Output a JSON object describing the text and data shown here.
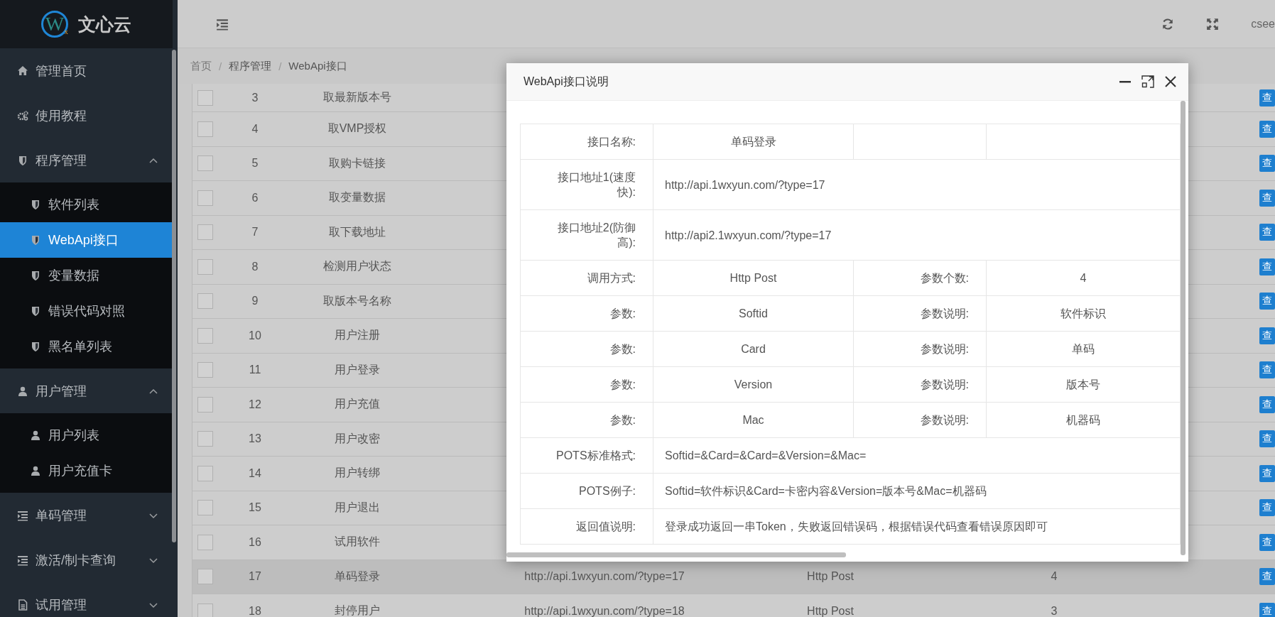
{
  "sidebar": {
    "logo_mark": "W",
    "logo_sub": "x",
    "brand": "文心云",
    "items": [
      {
        "label": "管理首页",
        "selected": false
      },
      {
        "label": "使用教程",
        "selected": false
      },
      {
        "label": "程序管理",
        "selected": false,
        "expanded": true,
        "children": [
          {
            "label": "软件列表",
            "selected": false
          },
          {
            "label": "WebApi接口",
            "selected": true
          },
          {
            "label": "变量数据",
            "selected": false
          },
          {
            "label": "错误代码对照",
            "selected": false
          },
          {
            "label": "黑名单列表",
            "selected": false
          }
        ]
      },
      {
        "label": "用户管理",
        "selected": false,
        "expanded": true,
        "children": [
          {
            "label": "用户列表",
            "selected": false
          },
          {
            "label": "用户充值卡",
            "selected": false
          }
        ]
      },
      {
        "label": "单码管理",
        "selected": false,
        "expanded": false
      },
      {
        "label": "激活/制卡查询",
        "selected": false,
        "expanded": false
      },
      {
        "label": "试用管理",
        "selected": false,
        "expanded": false
      }
    ]
  },
  "topbar": {
    "user": "csee"
  },
  "breadcrumb": {
    "separator": "/",
    "items": [
      "首页",
      "程序管理",
      "WebApi接口"
    ]
  },
  "table": {
    "rows": [
      {
        "index": "3",
        "name": "取最新版本号",
        "checked": false,
        "selected": false,
        "button": "查"
      },
      {
        "index": "4",
        "name": "取VMP授权",
        "checked": false,
        "selected": false,
        "button": "查"
      },
      {
        "index": "5",
        "name": "取购卡链接",
        "checked": false,
        "selected": false,
        "button": "查"
      },
      {
        "index": "6",
        "name": "取变量数据",
        "checked": false,
        "selected": false,
        "button": "查"
      },
      {
        "index": "7",
        "name": "取下载地址",
        "checked": false,
        "selected": false,
        "button": "查"
      },
      {
        "index": "8",
        "name": "检测用户状态",
        "checked": false,
        "selected": false,
        "button": "查"
      },
      {
        "index": "9",
        "name": "取版本号名称",
        "checked": false,
        "selected": false,
        "button": "查"
      },
      {
        "index": "10",
        "name": "用户注册",
        "checked": false,
        "selected": false,
        "button": "查"
      },
      {
        "index": "11",
        "name": "用户登录",
        "checked": false,
        "selected": false,
        "button": "查"
      },
      {
        "index": "12",
        "name": "用户充值",
        "checked": false,
        "selected": false,
        "button": "查"
      },
      {
        "index": "13",
        "name": "用户改密",
        "checked": false,
        "selected": false,
        "button": "查"
      },
      {
        "index": "14",
        "name": "用户转绑",
        "checked": false,
        "selected": false,
        "button": "查"
      },
      {
        "index": "15",
        "name": "用户退出",
        "checked": false,
        "selected": false,
        "button": "查"
      },
      {
        "index": "16",
        "name": "试用软件",
        "checked": false,
        "selected": false,
        "button": "查"
      },
      {
        "index": "17",
        "name": "单码登录",
        "checked": false,
        "selected": true,
        "url": "http://api.1wxyun.com/?type=17",
        "method": "Http Post",
        "param_count": "4",
        "button": "查"
      },
      {
        "index": "18",
        "name": "封停用户",
        "checked": false,
        "selected": false,
        "url": "http://api.1wxyun.com/?type=18",
        "method": "Http Post",
        "param_count": "3",
        "button": "查"
      }
    ]
  },
  "dialog": {
    "title": "WebApi接口说明",
    "rows": [
      {
        "kind": "quad",
        "cells": [
          "接口名称:",
          "单码登录"
        ]
      },
      {
        "kind": "wide",
        "cells": [
          "接口地址1(速度快):",
          {
            "text": "http://api.1wxyun.com/?type=17",
            "colspan": 3
          }
        ]
      },
      {
        "kind": "wide",
        "cells": [
          "接口地址2(防御高):",
          {
            "text": "http://api2.1wxyun.com/?type=17",
            "colspan": 3
          }
        ]
      },
      {
        "kind": "quad",
        "cells": [
          "调用方式:",
          "Http Post",
          "参数个数:",
          "4"
        ]
      },
      {
        "kind": "quad",
        "cells": [
          "参数:",
          "Softid",
          "参数说明:",
          "软件标识"
        ]
      },
      {
        "kind": "quad",
        "cells": [
          "参数:",
          "Card",
          "参数说明:",
          "单码"
        ]
      },
      {
        "kind": "quad",
        "cells": [
          "参数:",
          "Version",
          "参数说明:",
          "版本号"
        ]
      },
      {
        "kind": "quad",
        "cells": [
          "参数:",
          "Mac",
          "参数说明:",
          "机器码"
        ]
      },
      {
        "kind": "wide",
        "cells": [
          "POTS标准格式:",
          {
            "text": "Softid=&Card=&Card=&Version=&Mac=",
            "colspan": 3
          }
        ]
      },
      {
        "kind": "wide",
        "cells": [
          "POTS例子:",
          {
            "text": "Softid=软件标识&Card=卡密内容&Version=版本号&Mac=机器码",
            "colspan": 3
          }
        ]
      },
      {
        "kind": "wide",
        "cells": [
          "返回值说明:",
          {
            "text": "登录成功返回一串Token，失败返回错误码，根据错误代码查看错误原因即可",
            "colspan": 3
          }
        ]
      }
    ]
  }
}
